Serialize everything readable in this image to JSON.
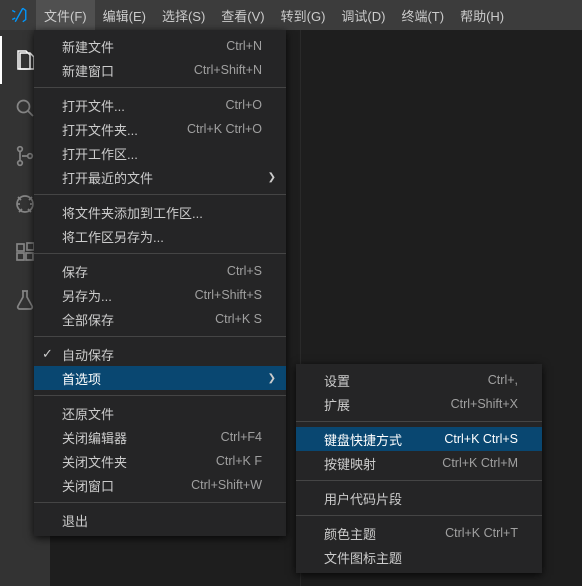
{
  "menubar": {
    "items": [
      "文件(F)",
      "编辑(E)",
      "选择(S)",
      "查看(V)",
      "转到(G)",
      "调试(D)",
      "终端(T)",
      "帮助(H)"
    ]
  },
  "file_menu": {
    "groups": [
      [
        {
          "label": "新建文件",
          "shortcut": "Ctrl+N"
        },
        {
          "label": "新建窗口",
          "shortcut": "Ctrl+Shift+N"
        }
      ],
      [
        {
          "label": "打开文件...",
          "shortcut": "Ctrl+O"
        },
        {
          "label": "打开文件夹...",
          "shortcut": "Ctrl+K Ctrl+O"
        },
        {
          "label": "打开工作区..."
        },
        {
          "label": "打开最近的文件",
          "submenu": true
        }
      ],
      [
        {
          "label": "将文件夹添加到工作区..."
        },
        {
          "label": "将工作区另存为..."
        }
      ],
      [
        {
          "label": "保存",
          "shortcut": "Ctrl+S"
        },
        {
          "label": "另存为...",
          "shortcut": "Ctrl+Shift+S"
        },
        {
          "label": "全部保存",
          "shortcut": "Ctrl+K S"
        }
      ],
      [
        {
          "label": "自动保存",
          "checked": true
        },
        {
          "label": "首选项",
          "submenu": true,
          "selected": true
        }
      ],
      [
        {
          "label": "还原文件"
        },
        {
          "label": "关闭编辑器",
          "shortcut": "Ctrl+F4"
        },
        {
          "label": "关闭文件夹",
          "shortcut": "Ctrl+K F"
        },
        {
          "label": "关闭窗口",
          "shortcut": "Ctrl+Shift+W"
        }
      ],
      [
        {
          "label": "退出"
        }
      ]
    ]
  },
  "pref_menu": {
    "groups": [
      [
        {
          "label": "设置",
          "shortcut": "Ctrl+,"
        },
        {
          "label": "扩展",
          "shortcut": "Ctrl+Shift+X"
        }
      ],
      [
        {
          "label": "键盘快捷方式",
          "shortcut": "Ctrl+K Ctrl+S",
          "selected": true
        },
        {
          "label": "按键映射",
          "shortcut": "Ctrl+K Ctrl+M"
        }
      ],
      [
        {
          "label": "用户代码片段"
        }
      ],
      [
        {
          "label": "颜色主题",
          "shortcut": "Ctrl+K Ctrl+T"
        },
        {
          "label": "文件图标主题"
        }
      ]
    ]
  },
  "activity_icons": [
    "files",
    "search",
    "scm",
    "debug",
    "extensions",
    "testing"
  ]
}
